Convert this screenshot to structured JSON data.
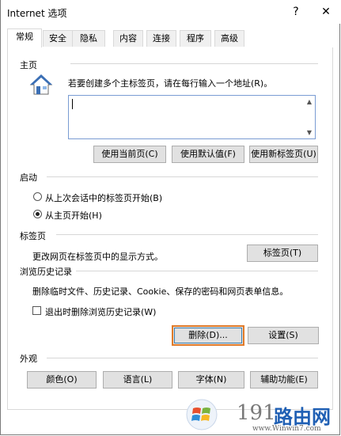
{
  "window": {
    "title": "Internet 选项",
    "help_glyph": "?",
    "close_glyph": "✕"
  },
  "tabs": [
    {
      "label": "常规"
    },
    {
      "label": "安全"
    },
    {
      "label": "隐私"
    },
    {
      "label": "内容"
    },
    {
      "label": "连接"
    },
    {
      "label": "程序"
    },
    {
      "label": "高级"
    }
  ],
  "home": {
    "title": "主页",
    "desc": "若要创建多个主标签页，请在每行输入一个地址(R)。",
    "value": "",
    "btn_current": "使用当前页(C)",
    "btn_default": "使用默认值(F)",
    "btn_newtab": "使用新标签页(U)",
    "icon": "home-icon"
  },
  "startup": {
    "title": "启动",
    "opt_last": "从上次会话中的标签页开始(B)",
    "opt_home": "从主页开始(H)",
    "selected": "opt_home"
  },
  "tabs_section": {
    "title": "标签页",
    "desc": "更改网页在标签页中的显示方式。",
    "btn": "标签页(T)"
  },
  "history": {
    "title": "浏览历史记录",
    "desc": "删除临时文件、历史记录、Cookie、保存的密码和网页表单信息。",
    "checkbox": "退出时删除浏览历史记录(W)",
    "checked": false,
    "btn_delete": "删除(D)...",
    "btn_settings": "设置(S)"
  },
  "appearance": {
    "title": "外观",
    "btn_colors": "颜色(O)",
    "btn_language": "语言(L)",
    "btn_fonts": "字体(N)",
    "btn_accessibility": "辅助功能(E)"
  },
  "watermark": {
    "text_big": "路由网",
    "text_digits": "191",
    "url": "www.Winwin7.com"
  },
  "colors": {
    "focus_border": "#e07b2a",
    "house_roof": "#3b6fb5"
  }
}
